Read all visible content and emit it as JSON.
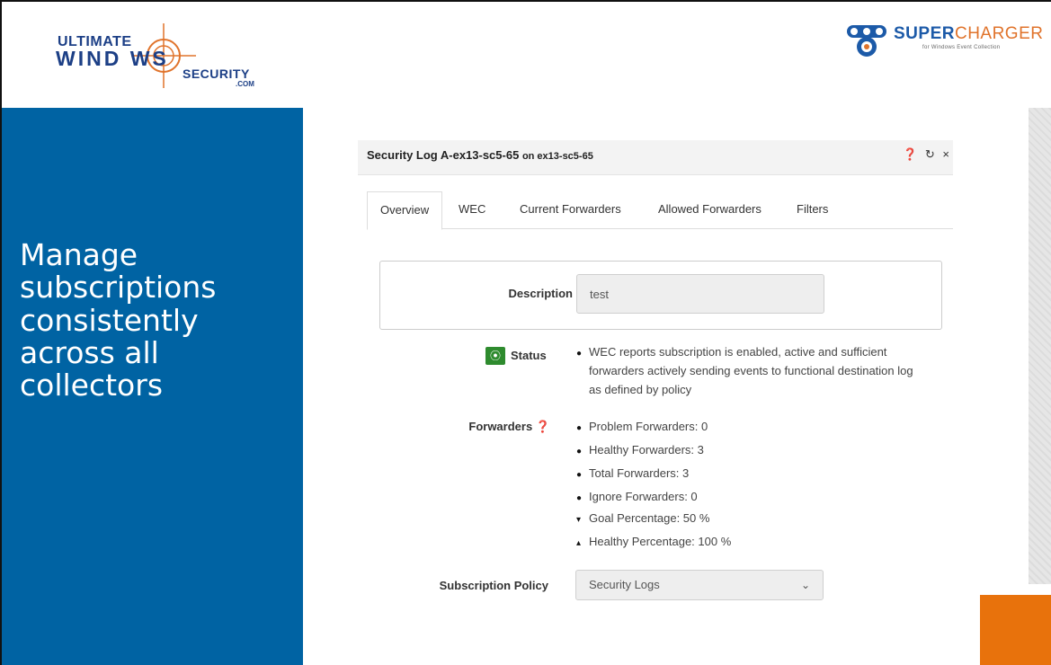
{
  "branding": {
    "uws_line1": "ULTIMATE",
    "uws_line2": "WIND WS",
    "uws_line3": "SECURITY",
    "uws_line4": ".COM",
    "sc_title_a": "SUPER",
    "sc_title_b": "CHARGER",
    "sc_subtitle": "for Windows Event Collection"
  },
  "slide": {
    "headline": "Manage subscriptions consistently across all collectors"
  },
  "dialog": {
    "title": "Security Log A-ex13-sc5-65",
    "title_on": "on ex13-sc5-65",
    "help_icon": "❓",
    "refresh_icon": "⟳",
    "close_icon": "×"
  },
  "tabs": [
    "Overview",
    "WEC",
    "Current Forwarders",
    "Allowed Forwarders",
    "Filters"
  ],
  "overview": {
    "description_label": "Description",
    "description_value": "test",
    "status_label": "Status",
    "status_lines": [
      "WEC reports subscription is enabled, active and sufficient",
      "forwarders actively sending events to functional destination log",
      "as defined by policy"
    ],
    "forwarders_label": "Forwarders",
    "forwarders": [
      {
        "marker": "●",
        "text": "Problem Forwarders: 0"
      },
      {
        "marker": "●",
        "text": "Healthy Forwarders: 3"
      },
      {
        "marker": "●",
        "text": "Total Forwarders: 3"
      },
      {
        "marker": "●",
        "text": "Ignore Forwarders: 0"
      },
      {
        "marker": "▾",
        "text": "Goal Percentage: 50 %"
      },
      {
        "marker": "▴",
        "text": "Healthy Percentage: 100 %"
      }
    ],
    "policy_label": "Subscription Policy",
    "policy_value": "Security Logs"
  },
  "colors": {
    "left_panel": "#0063a3",
    "accent_orange": "#e8720c",
    "status_green": "#2e8b2e"
  }
}
